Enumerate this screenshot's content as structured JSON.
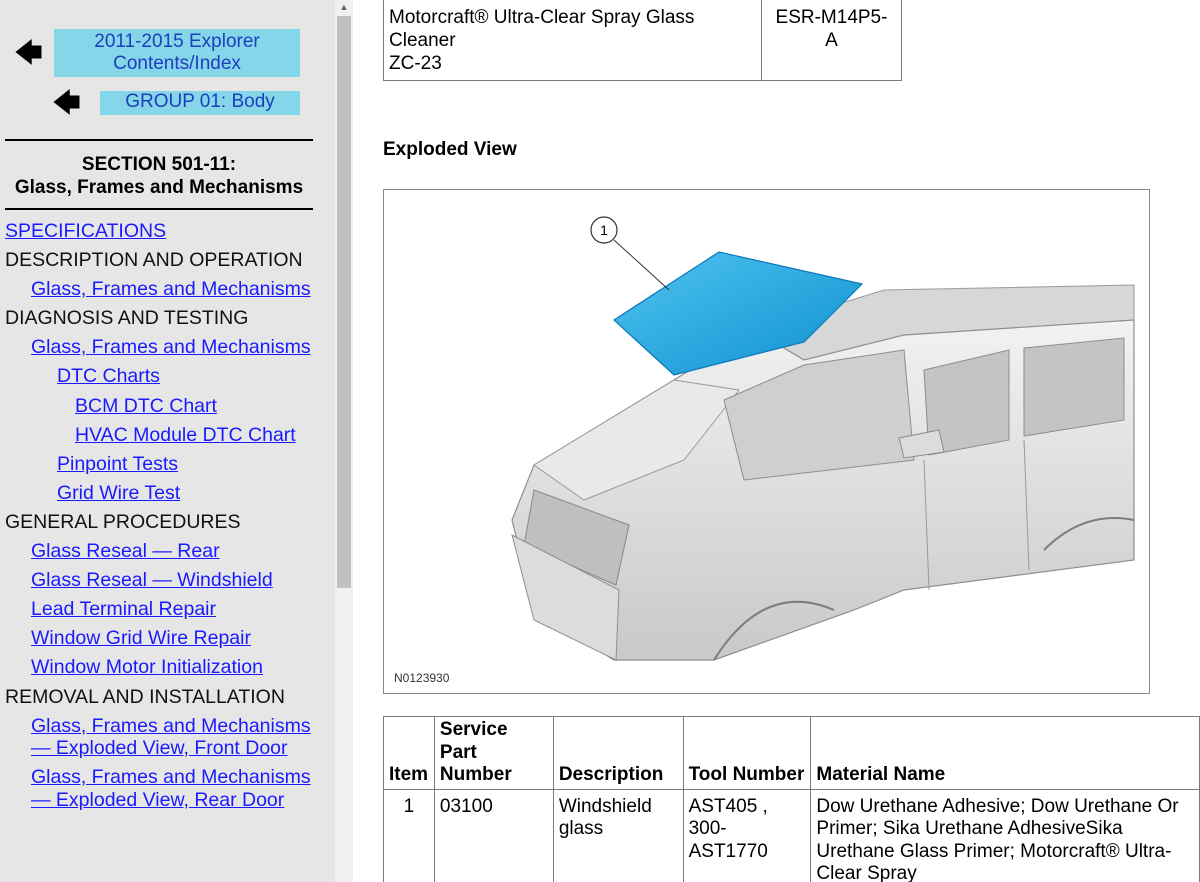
{
  "nav": {
    "back_arrow": "🡄",
    "top_link_line1": "2011-2015 Explorer",
    "top_link_line2": "Contents/Index",
    "group_link": "GROUP 01: Body",
    "section_line1": "SECTION 501-11:",
    "section_line2": "Glass, Frames and Mechanisms",
    "toc": [
      {
        "label": "SPECIFICATIONS",
        "level": 0,
        "link": true
      },
      {
        "label": "DESCRIPTION AND OPERATION",
        "level": 0,
        "link": false
      },
      {
        "label": "Glass, Frames and Mechanisms",
        "level": 1,
        "link": true
      },
      {
        "label": "DIAGNOSIS AND TESTING",
        "level": 0,
        "link": false
      },
      {
        "label": "Glass, Frames and Mechanisms",
        "level": 1,
        "link": true
      },
      {
        "label": "DTC Charts",
        "level": 2,
        "link": true
      },
      {
        "label": "BCM DTC Chart",
        "level": 3,
        "link": true
      },
      {
        "label": "HVAC Module DTC Chart",
        "level": 3,
        "link": true
      },
      {
        "label": "Pinpoint Tests",
        "level": 2,
        "link": true
      },
      {
        "label": "Grid Wire Test",
        "level": 2,
        "link": true
      },
      {
        "label": "GENERAL PROCEDURES",
        "level": 0,
        "link": false
      },
      {
        "label": "Glass Reseal — Rear",
        "level": 1,
        "link": true
      },
      {
        "label": "Glass Reseal — Windshield",
        "level": 1,
        "link": true
      },
      {
        "label": "Lead Terminal Repair",
        "level": 1,
        "link": true
      },
      {
        "label": "Window Grid Wire Repair",
        "level": 1,
        "link": true
      },
      {
        "label": "Window Motor Initialization",
        "level": 1,
        "link": true
      },
      {
        "label": "REMOVAL AND INSTALLATION",
        "level": 0,
        "link": false
      },
      {
        "label": "Glass, Frames and Mechanisms — Exploded View, Front Door",
        "level": 1,
        "link": true
      },
      {
        "label": "Glass, Frames and Mechanisms — Exploded View, Rear Door",
        "level": 1,
        "link": true
      }
    ]
  },
  "scrollbar": {
    "up_glyph": "▲"
  },
  "content": {
    "top_table": {
      "material_line1": "Motorcraft® Ultra-Clear Spray Glass",
      "material_line2": "Cleaner",
      "material_line3": "ZC-23",
      "spec_line1": "ESR-M14P5-",
      "spec_line2": "A"
    },
    "exploded_title": "Exploded View",
    "figure": {
      "callout": "1",
      "figure_id": "N0123930",
      "highlight_color": "#1aa3e0"
    },
    "parts_table": {
      "headers": {
        "item": "Item",
        "service_part_number": "Service Part Number",
        "description": "Description",
        "tool_number": "Tool Number",
        "material_name": "Material Name"
      },
      "rows": [
        {
          "item": "1",
          "service_part_number": "03100",
          "description": "Windshield glass",
          "tool_number": "AST405 , 300-AST1770",
          "material_name": "Dow Urethane Adhesive; Dow Urethane Or Primer; Sika Urethane AdhesiveSika Urethane Glass Primer; Motorcraft® Ultra-Clear Spray"
        }
      ]
    }
  }
}
